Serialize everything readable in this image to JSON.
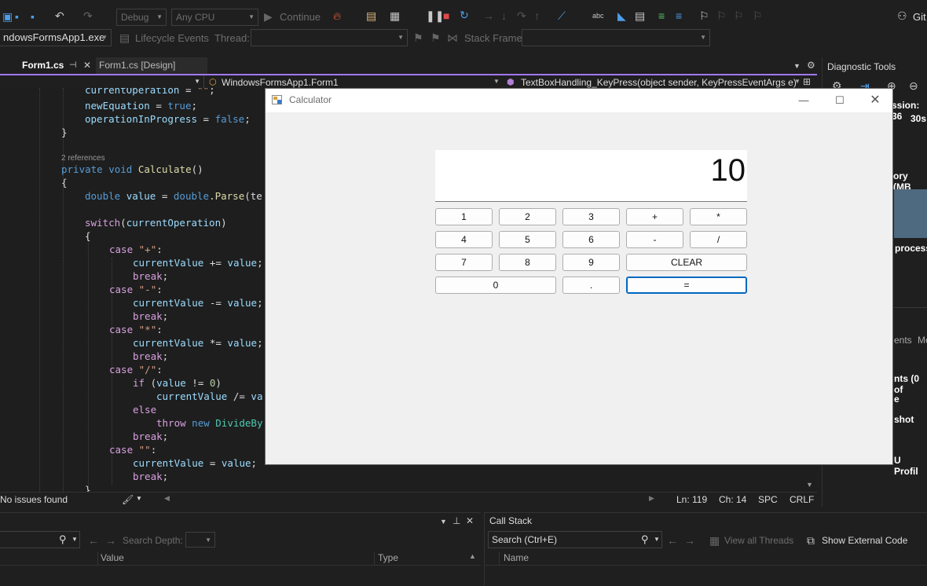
{
  "toolbar": {
    "config": "Debug",
    "platform": "Any CPU",
    "continue": "Continue",
    "account": "Git",
    "process": "ndowsFormsApp1.exe",
    "lifecycle": "Lifecycle Events",
    "thread_label": "Thread:",
    "stackframe_label": "Stack Frame:"
  },
  "tabs": {
    "active": "Form1.cs",
    "pin": "⊣",
    "close": "✕",
    "design": "Form1.cs [Design]"
  },
  "navbar": {
    "class": "WindowsFormsApp1.Form1",
    "member": "TextBoxHandling_KeyPress(object sender, KeyPressEventArgs e)"
  },
  "code": {
    "refs": "2 references"
  },
  "status": {
    "issues": "No issues found",
    "line": "Ln: 119",
    "ch": "Ch: 14",
    "spc": "SPC",
    "crlf": "CRLF"
  },
  "diagnostics": {
    "title": "Diagnostic Tools",
    "session": "ssion: 36",
    "time": "30s",
    "memory": "ory (MB",
    "process": "process",
    "tab_events": "ents",
    "tab_mem": "Me",
    "events": "nts (0 of",
    "item_e": "e",
    "snapshot": "shot",
    "profile": "U Profil"
  },
  "bottom_left": {
    "search_depth": "Search Depth:",
    "col_value": "Value",
    "col_type": "Type"
  },
  "callstack": {
    "title": "Call Stack",
    "search": "Search (Ctrl+E)",
    "view_threads": "View all Threads",
    "show_external": "Show External Code",
    "col_name": "Name"
  },
  "calculator": {
    "title": "Calculator",
    "display": "10",
    "buttons": {
      "b1": "1",
      "b2": "2",
      "b3": "3",
      "plus": "+",
      "mul": "*",
      "b4": "4",
      "b5": "5",
      "b6": "6",
      "minus": "-",
      "div": "/",
      "b7": "7",
      "b8": "8",
      "b9": "9",
      "clear": "CLEAR",
      "b0": "0",
      "dot": ".",
      "eq": "="
    }
  }
}
